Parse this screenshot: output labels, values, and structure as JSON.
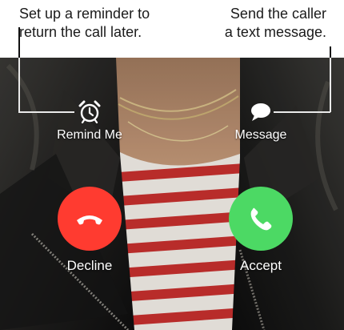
{
  "callouts": {
    "left": {
      "line1": "Set up a reminder to",
      "line2": "return the call later."
    },
    "right": {
      "line1": "Send the caller",
      "line2": "a text message."
    }
  },
  "actions": {
    "remind_me": {
      "label": "Remind Me",
      "icon": "alarm-clock-icon"
    },
    "message": {
      "label": "Message",
      "icon": "message-bubble-icon"
    },
    "decline": {
      "label": "Decline",
      "icon": "phone-hangup-icon",
      "color": "#ff3b30"
    },
    "accept": {
      "label": "Accept",
      "icon": "phone-icon",
      "color": "#4cd964"
    }
  }
}
